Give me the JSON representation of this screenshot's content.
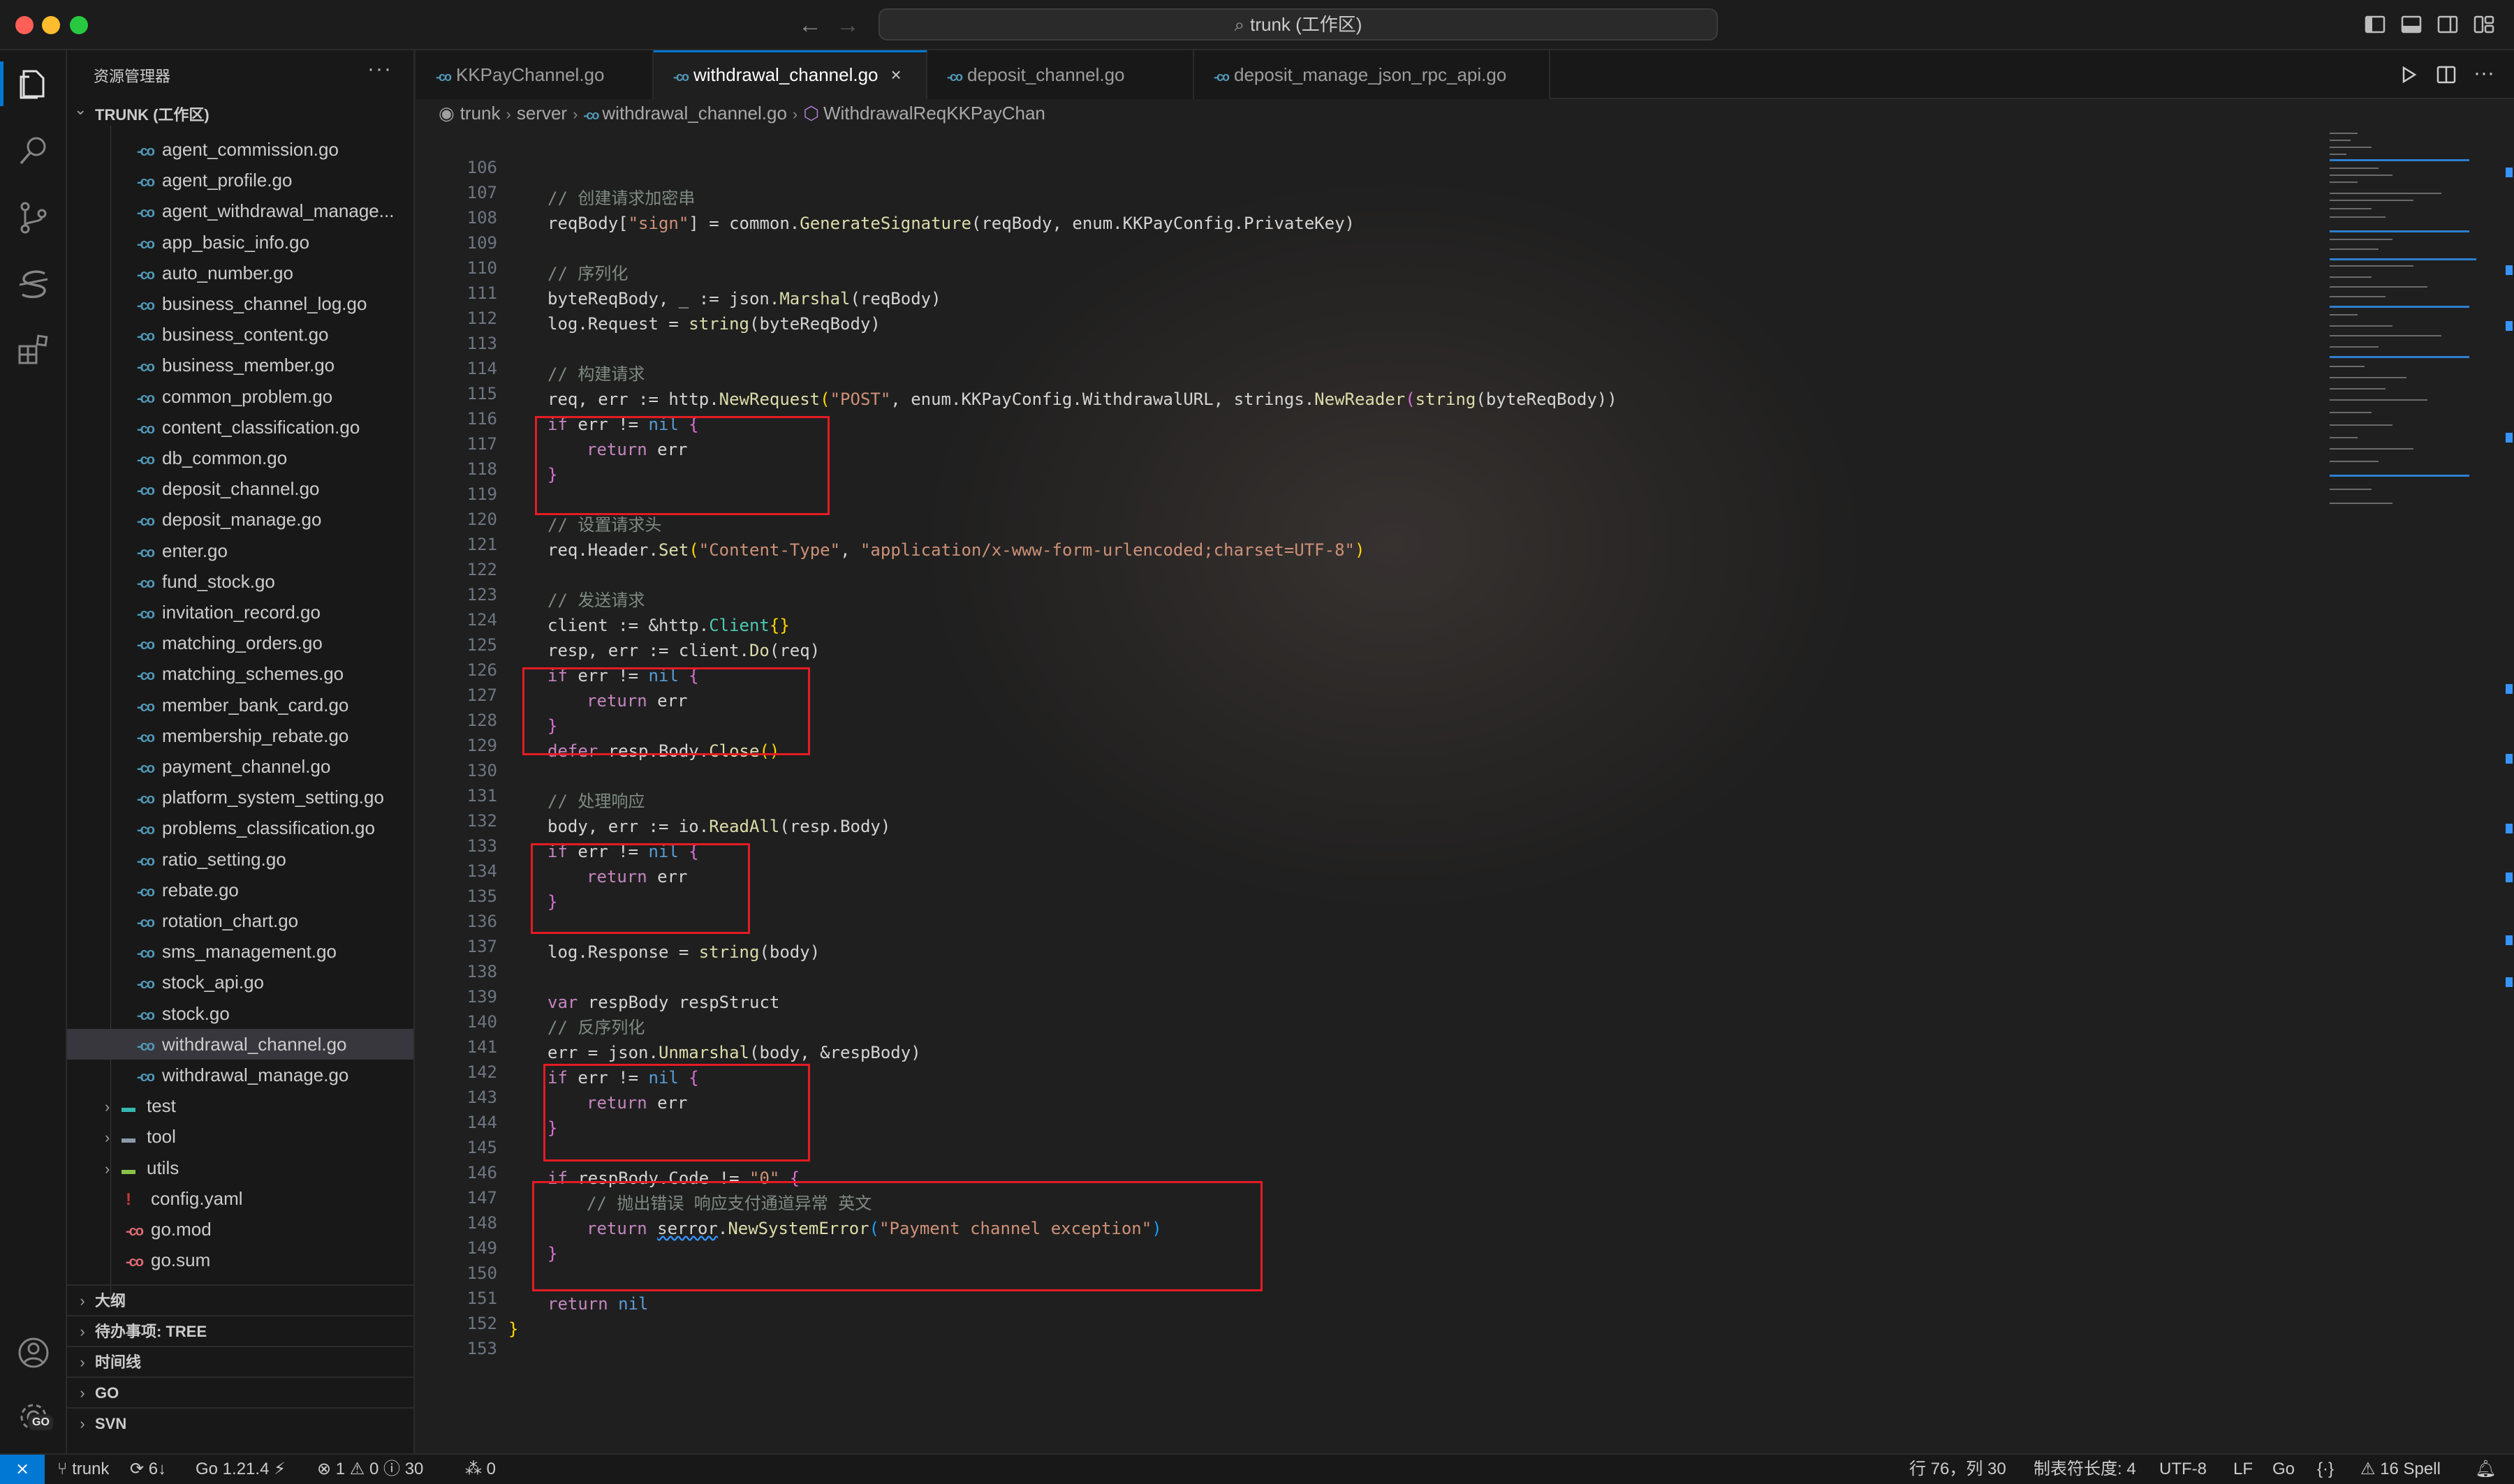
{
  "window": {
    "search_label": "trunk (工作区)",
    "colors": {
      "accent": "#0078d4",
      "highlight_box": "#e51b23",
      "go_icon": "#519aba"
    }
  },
  "activity_bar": {
    "items": [
      "explorer-icon",
      "search-icon",
      "source-control-icon",
      "svn-icon",
      "extensions-icon",
      "account-icon",
      "manage-icon"
    ],
    "go_badge": "GO"
  },
  "sidebar": {
    "header": "资源管理器",
    "workspace": "TRUNK (工作区)",
    "files": [
      "agent_commission.go",
      "agent_profile.go",
      "agent_withdrawal_manage...",
      "app_basic_info.go",
      "auto_number.go",
      "business_channel_log.go",
      "business_content.go",
      "business_member.go",
      "common_problem.go",
      "content_classification.go",
      "db_common.go",
      "deposit_channel.go",
      "deposit_manage.go",
      "enter.go",
      "fund_stock.go",
      "invitation_record.go",
      "matching_orders.go",
      "matching_schemes.go",
      "member_bank_card.go",
      "membership_rebate.go",
      "payment_channel.go",
      "platform_system_setting.go",
      "problems_classification.go",
      "ratio_setting.go",
      "rebate.go",
      "rotation_chart.go",
      "sms_management.go",
      "stock_api.go",
      "stock.go",
      "withdrawal_channel.go",
      "withdrawal_manage.go"
    ],
    "folders": [
      "test",
      "tool",
      "utils"
    ],
    "root_files": [
      "config.yaml",
      "go.mod",
      "go.sum"
    ],
    "sections": [
      "大纲",
      "待办事项: TREE",
      "时间线",
      "GO",
      "SVN"
    ]
  },
  "tabs": [
    {
      "label": "KKPayChannel.go",
      "active": false
    },
    {
      "label": "withdrawal_channel.go",
      "active": true
    },
    {
      "label": "deposit_channel.go",
      "active": false
    },
    {
      "label": "deposit_manage_json_rpc_api.go",
      "active": false
    }
  ],
  "breadcrumb": [
    "trunk",
    "server",
    "withdrawal_channel.go",
    "WithdrawalReqKKPayChan"
  ],
  "editor": {
    "line_numbers": [
      "106",
      "107",
      "108",
      "109",
      "110",
      "111",
      "112",
      "113",
      "114",
      "115",
      "116",
      "117",
      "118",
      "119",
      "120",
      "121",
      "122",
      "123",
      "124",
      "125",
      "126",
      "127",
      "128",
      "129",
      "130",
      "131",
      "132",
      "133",
      "134",
      "135",
      "136",
      "137",
      "138",
      "139",
      "140",
      "141",
      "142",
      "143",
      "144",
      "145",
      "146",
      "147",
      "148",
      "149",
      "150",
      "151",
      "152",
      "153"
    ],
    "code": {
      "c107": "// 创建请求加密串",
      "c108a": "reqBody[",
      "c108b": "\"sign\"",
      "c108c": "] = common.",
      "c108d": "GenerateSignature",
      "c108e": "(reqBody, enum.KKPayConfig.PrivateKey)",
      "c110": "// 序列化",
      "c111a": "byteReqBody, _ := json.",
      "c111b": "Marshal",
      "c111c": "(reqBody)",
      "c112a": "log.Request = ",
      "c112b": "string",
      "c112c": "(byteReqBody)",
      "c114": "// 构建请求",
      "c115a": "req, err := http.",
      "c115b": "NewRequest",
      "c115c": "(",
      "c115d": "\"POST\"",
      "c115e": ", enum.KKPayConfig.WithdrawalURL, strings.",
      "c115f": "NewReader",
      "c115g": "(",
      "c115h": "string",
      "c115i": "(byteReqBody))",
      "if_kw": "if",
      "err_ne": " err != ",
      "nil_kw": "nil",
      "lbrace": " {",
      "rbrace": "}",
      "return_kw": "return",
      "err_word": " err",
      "c120": "// 设置请求头",
      "c121a": "req.Header.",
      "c121b": "Set",
      "c121c": "(",
      "c121d": "\"Content-Type\"",
      "c121e": ", ",
      "c121f": "\"application/x-www-form-urlencoded;charset=UTF-8\"",
      "c121g": ")",
      "c123": "// 发送请求",
      "c124a": "client := &http.",
      "c124b": "Client",
      "c124c": "{}",
      "c125a": "resp, err := client.",
      "c125b": "Do",
      "c125c": "(req)",
      "c129a": "defer",
      "c129b": " resp.Body.",
      "c129c": "Close",
      "c129d": "()",
      "c131": "// 处理响应",
      "c132a": "body, err := io.",
      "c132b": "ReadAll",
      "c132c": "(resp.Body)",
      "c137a": "log.Response = ",
      "c137b": "string",
      "c137c": "(body)",
      "c139a": "var",
      "c139b": " respBody respStruct",
      "c140": "// 反序列化",
      "c141a": "err = json.",
      "c141b": "Unmarshal",
      "c141c": "(body, &respBody)",
      "c146a": " respBody.Code != ",
      "c146b": "\"0\"",
      "c147": "// 抛出错误 响应支付通道异常 英文",
      "c148a": "serror",
      "c148b": ".",
      "c148c": "NewSystemError",
      "c148d": "(",
      "c148e": "\"Payment channel exception\"",
      "c148f": ")",
      "c151b": " nil"
    }
  },
  "statusbar": {
    "branch": "trunk",
    "sync": "6↓",
    "go_version": "Go 1.21.4",
    "errors": "1",
    "warnings": "0",
    "infos": "30",
    "ports": "0",
    "cursor": "行 76，列 30",
    "tab_size": "制表符长度: 4",
    "encoding": "UTF-8",
    "eol": "LF",
    "language": "Go",
    "spell": "16 Spell"
  }
}
